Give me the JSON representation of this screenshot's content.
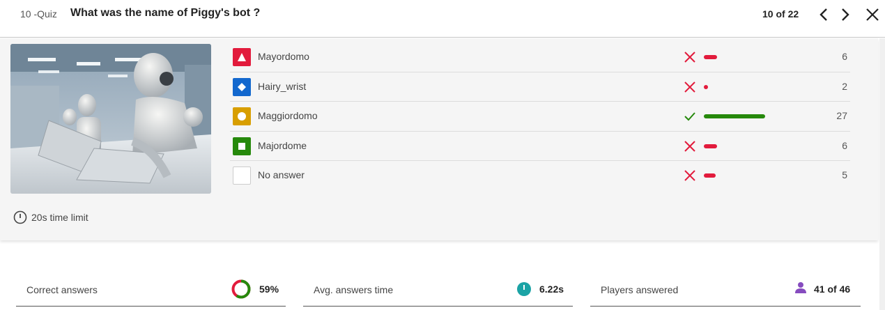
{
  "header": {
    "prefix": "10 -Quiz",
    "title": "What was the name of Piggy's bot ?",
    "counter": "10 of 22",
    "prev_icon": "chevron-left-icon",
    "next_icon": "chevron-right-icon",
    "close_icon": "close-icon"
  },
  "question": {
    "time_limit": "20s time limit"
  },
  "answers": [
    {
      "label": "Mayordomo",
      "shape": "triangle",
      "color": "#e21b3c",
      "correct": false,
      "count": "6",
      "share": 0.22
    },
    {
      "label": "Hairy_wrist",
      "shape": "diamond",
      "color": "#1368ce",
      "correct": false,
      "count": "2",
      "share": 0.07
    },
    {
      "label": "Maggiordomo",
      "shape": "circle",
      "color": "#d89e00",
      "correct": true,
      "count": "27",
      "share": 1.0
    },
    {
      "label": "Majordome",
      "shape": "square",
      "color": "#26890c",
      "correct": false,
      "count": "6",
      "share": 0.22
    },
    {
      "label": "No answer",
      "shape": "none",
      "color": "#ffffff",
      "correct": false,
      "count": "5",
      "share": 0.19
    }
  ],
  "stats": {
    "correct": {
      "label": "Correct answers",
      "value": "59%",
      "fraction": 0.59
    },
    "avg_time": {
      "label": "Avg. answers time",
      "value": "6.22s"
    },
    "players": {
      "label": "Players answered",
      "value": "41 of 46"
    }
  },
  "colors": {
    "correct": "#26890c",
    "wrong": "#e21b3c",
    "timer": "#1ba3a5",
    "player": "#864cbf"
  }
}
